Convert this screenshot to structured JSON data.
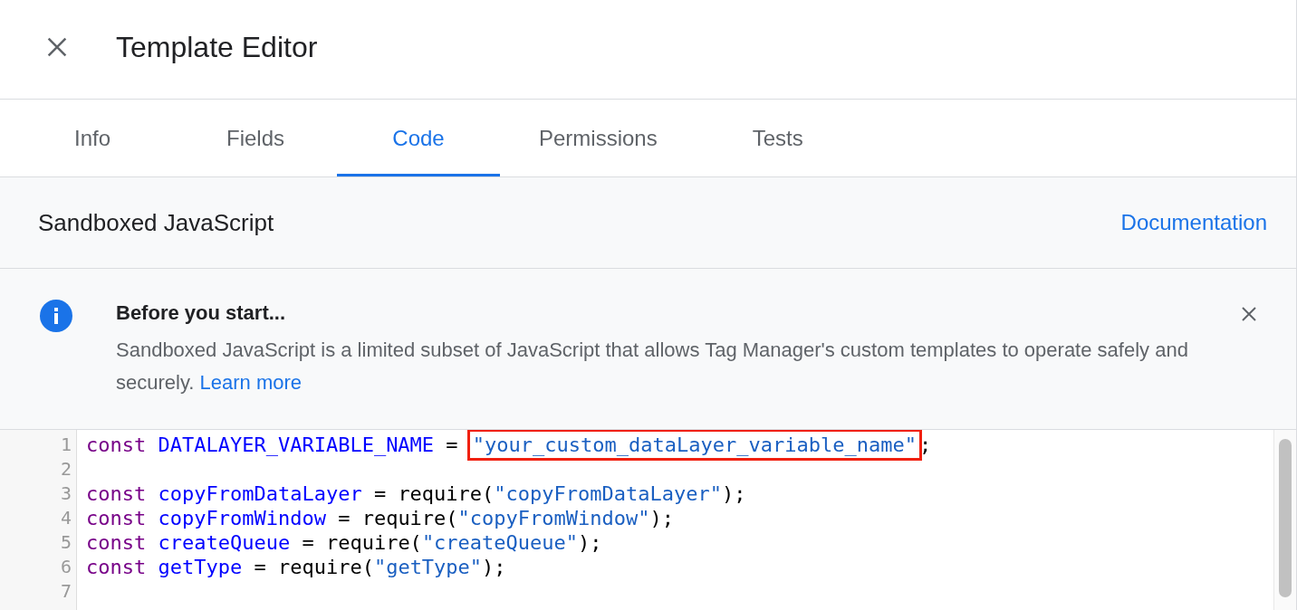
{
  "dialog": {
    "title": "Template Editor"
  },
  "tabs": [
    {
      "label": "Info",
      "selected": false
    },
    {
      "label": "Fields",
      "selected": false
    },
    {
      "label": "Code",
      "selected": true
    },
    {
      "label": "Permissions",
      "selected": false
    },
    {
      "label": "Tests",
      "selected": false
    }
  ],
  "section": {
    "title": "Sandboxed JavaScript",
    "link": "Documentation"
  },
  "notice": {
    "title": "Before you start...",
    "body": "Sandboxed JavaScript is a limited subset of JavaScript that allows Tag Manager's custom templates to operate safely and securely.",
    "link": "Learn more"
  },
  "code_lines": [
    {
      "number": "1",
      "tokens": [
        {
          "kind": "keyword",
          "text": "const"
        },
        {
          "kind": "variable",
          "text": "DATALAYER_VARIABLE_NAME"
        },
        {
          "kind": "plain",
          "text": " = "
        },
        {
          "kind": "string",
          "text": "\"your_custom_dataLayer_variable_name\"",
          "highlighted": true
        },
        {
          "kind": "plain",
          "text": ";"
        }
      ]
    },
    {
      "number": "2"
    },
    {
      "number": "3",
      "tokens": [
        {
          "kind": "keyword",
          "text": "const"
        },
        {
          "kind": "variable",
          "text": "copyFromDataLayer"
        },
        {
          "kind": "plain",
          "text": " = require("
        },
        {
          "kind": "string",
          "text": "\"copyFromDataLayer\"",
          "highlighted": false
        },
        {
          "kind": "plain",
          "text": ");"
        }
      ]
    },
    {
      "number": "4",
      "tokens": [
        {
          "kind": "keyword",
          "text": "const"
        },
        {
          "kind": "variable",
          "text": "copyFromWindow"
        },
        {
          "kind": "plain",
          "text": " = require("
        },
        {
          "kind": "string",
          "text": "\"copyFromWindow\"",
          "highlighted": false
        },
        {
          "kind": "plain",
          "text": ");"
        }
      ]
    },
    {
      "number": "5",
      "tokens": [
        {
          "kind": "keyword",
          "text": "const"
        },
        {
          "kind": "variable",
          "text": "createQueue"
        },
        {
          "kind": "plain",
          "text": " = require("
        },
        {
          "kind": "string",
          "text": "\"createQueue\"",
          "highlighted": false
        },
        {
          "kind": "plain",
          "text": ");"
        }
      ]
    },
    {
      "number": "6",
      "tokens": [
        {
          "kind": "keyword",
          "text": "const"
        },
        {
          "kind": "variable",
          "text": "getType"
        },
        {
          "kind": "plain",
          "text": " = require("
        },
        {
          "kind": "string",
          "text": "\"getType\"",
          "highlighted": false
        },
        {
          "kind": "plain",
          "text": ");"
        }
      ]
    },
    {
      "number": "7"
    }
  ]
}
